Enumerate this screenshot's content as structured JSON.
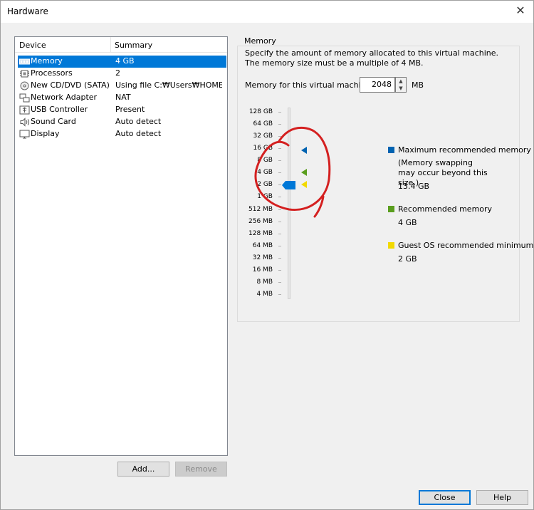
{
  "window": {
    "title": "Hardware",
    "close_symbol": "✕"
  },
  "device_list": {
    "headers": {
      "device": "Device",
      "summary": "Summary"
    },
    "items": [
      {
        "name": "Memory",
        "summary": "4 GB",
        "icon": "memory-icon",
        "selected": true
      },
      {
        "name": "Processors",
        "summary": "2",
        "icon": "processor-icon",
        "selected": false
      },
      {
        "name": "New CD/DVD (SATA)",
        "summary": "Using file C:₩Users₩HOME...",
        "icon": "cd-dvd-icon",
        "selected": false
      },
      {
        "name": "Network Adapter",
        "summary": "NAT",
        "icon": "network-adapter-icon",
        "selected": false
      },
      {
        "name": "USB Controller",
        "summary": "Present",
        "icon": "usb-icon",
        "selected": false
      },
      {
        "name": "Sound Card",
        "summary": "Auto detect",
        "icon": "speaker-icon",
        "selected": false
      },
      {
        "name": "Display",
        "summary": "Auto detect",
        "icon": "monitor-icon",
        "selected": false
      }
    ]
  },
  "buttons": {
    "add": "Add...",
    "remove": "Remove",
    "close": "Close",
    "help": "Help"
  },
  "memory": {
    "group_title": "Memory",
    "description": "Specify the amount of memory allocated to this virtual machine. The memory size must be a multiple of 4 MB.",
    "input_label": "Memory for this virtual machine:",
    "value": "2048",
    "unit": "MB",
    "scale_labels": [
      "128 GB",
      "64 GB",
      "32 GB",
      "16 GB",
      "8 GB",
      "4 GB",
      "2 GB",
      "1 GB",
      "512 MB",
      "256 MB",
      "128 MB",
      "64 MB",
      "32 MB",
      "16 MB",
      "8 MB",
      "4 MB"
    ],
    "slider_value": "2 GB",
    "markers": {
      "maximum_recommended": "16 GB",
      "recommended": "4 GB",
      "guest_minimum": "2 GB"
    }
  },
  "legend": {
    "max_label": "Maximum recommended memory",
    "max_note": "(Memory swapping may occur beyond this size.)",
    "max_value": "13.4 GB",
    "rec_label": "Recommended memory",
    "rec_value": "4 GB",
    "min_label": "Guest OS recommended minimum",
    "min_value": "2 GB"
  },
  "colors": {
    "accent": "#0078d7",
    "max": "#0063b1",
    "recommended": "#5a9e1e",
    "minimum": "#f2d900",
    "annotation": "#d42020"
  }
}
